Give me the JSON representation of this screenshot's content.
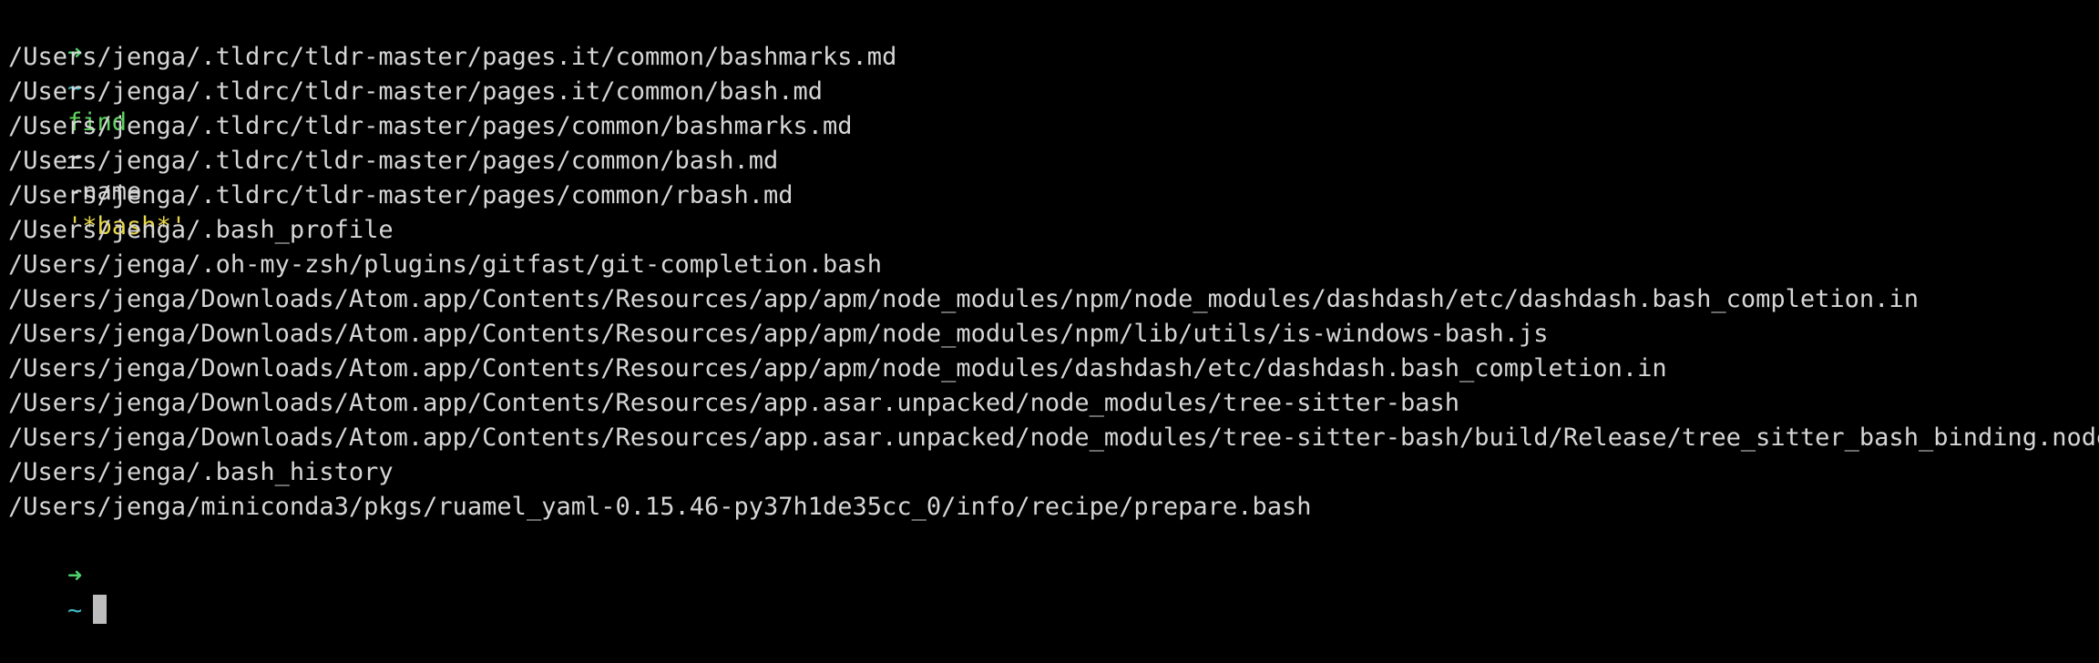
{
  "colors": {
    "background": "#000000",
    "prompt_arrow": "#4fd16b",
    "prompt_dir": "#3fb9c2",
    "command": "#5fd35f",
    "string": "#e8d64a",
    "output": "#d6d6d6",
    "cursor": "#bdbdbd"
  },
  "prompt": {
    "arrow": "➜",
    "dir": "~"
  },
  "command": {
    "name": "find",
    "path_arg": "~",
    "option": "-name",
    "pattern": "'*bash*'"
  },
  "output": [
    "/Users/jenga/.tldrc/tldr-master/pages.it/common/bashmarks.md",
    "/Users/jenga/.tldrc/tldr-master/pages.it/common/bash.md",
    "/Users/jenga/.tldrc/tldr-master/pages/common/bashmarks.md",
    "/Users/jenga/.tldrc/tldr-master/pages/common/bash.md",
    "/Users/jenga/.tldrc/tldr-master/pages/common/rbash.md",
    "/Users/jenga/.bash_profile",
    "/Users/jenga/.oh-my-zsh/plugins/gitfast/git-completion.bash",
    "/Users/jenga/Downloads/Atom.app/Contents/Resources/app/apm/node_modules/npm/node_modules/dashdash/etc/dashdash.bash_completion.in",
    "/Users/jenga/Downloads/Atom.app/Contents/Resources/app/apm/node_modules/npm/lib/utils/is-windows-bash.js",
    "/Users/jenga/Downloads/Atom.app/Contents/Resources/app/apm/node_modules/dashdash/etc/dashdash.bash_completion.in",
    "/Users/jenga/Downloads/Atom.app/Contents/Resources/app.asar.unpacked/node_modules/tree-sitter-bash",
    "/Users/jenga/Downloads/Atom.app/Contents/Resources/app.asar.unpacked/node_modules/tree-sitter-bash/build/Release/tree_sitter_bash_binding.node",
    "/Users/jenga/.bash_history",
    "/Users/jenga/miniconda3/pkgs/ruamel_yaml-0.15.46-py37h1de35cc_0/info/recipe/prepare.bash"
  ]
}
